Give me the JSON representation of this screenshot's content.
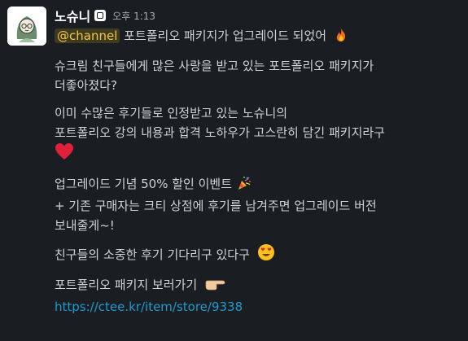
{
  "message": {
    "username": "노슈니",
    "timestamp": "오후 1:13",
    "mention": "@channel",
    "line1_text": "포트폴리오 패키지가 업그레이드 되었어",
    "p1_l1": "슈크림 친구들에게 많은 사랑을 받고 있는 포트폴리오 패키지가",
    "p1_l2": "더좋아졌다?",
    "p2_l1": "이미 수많은 후기들로 인정받고 있는 노슈니의",
    "p2_l2": "포트폴리오 강의 내용과 합격 노하우가 고스란히 담긴 패키지라구",
    "p3_l1": "업그레이드 기념 50% 할인 이벤트",
    "p3_l2": "+ 기존 구매자는 크티 상점에 후기를 남겨주면 업그레이드 버전",
    "p3_l3": "보내줄게~!",
    "p4_l1": "친구들의 소중한 후기 기다리구 있다구",
    "p5_l1": "포트폴리오 패키지 보러가기",
    "link": "https://ctee.kr/item/store/9338"
  },
  "icons": {
    "avatar": "illustrated-avatar",
    "app_badge": "app-badge-icon",
    "fire": "fire-icon",
    "heart": "red-heart-icon",
    "party": "party-popper-icon",
    "heart_eyes": "heart-eyes-icon",
    "pointing": "pointing-right-icon"
  },
  "colors": {
    "background": "#1a1d21",
    "text": "#d1d2d3",
    "mention_bg": "#3e3a20",
    "mention_text": "#f2c744",
    "link": "#1d9bd1"
  }
}
